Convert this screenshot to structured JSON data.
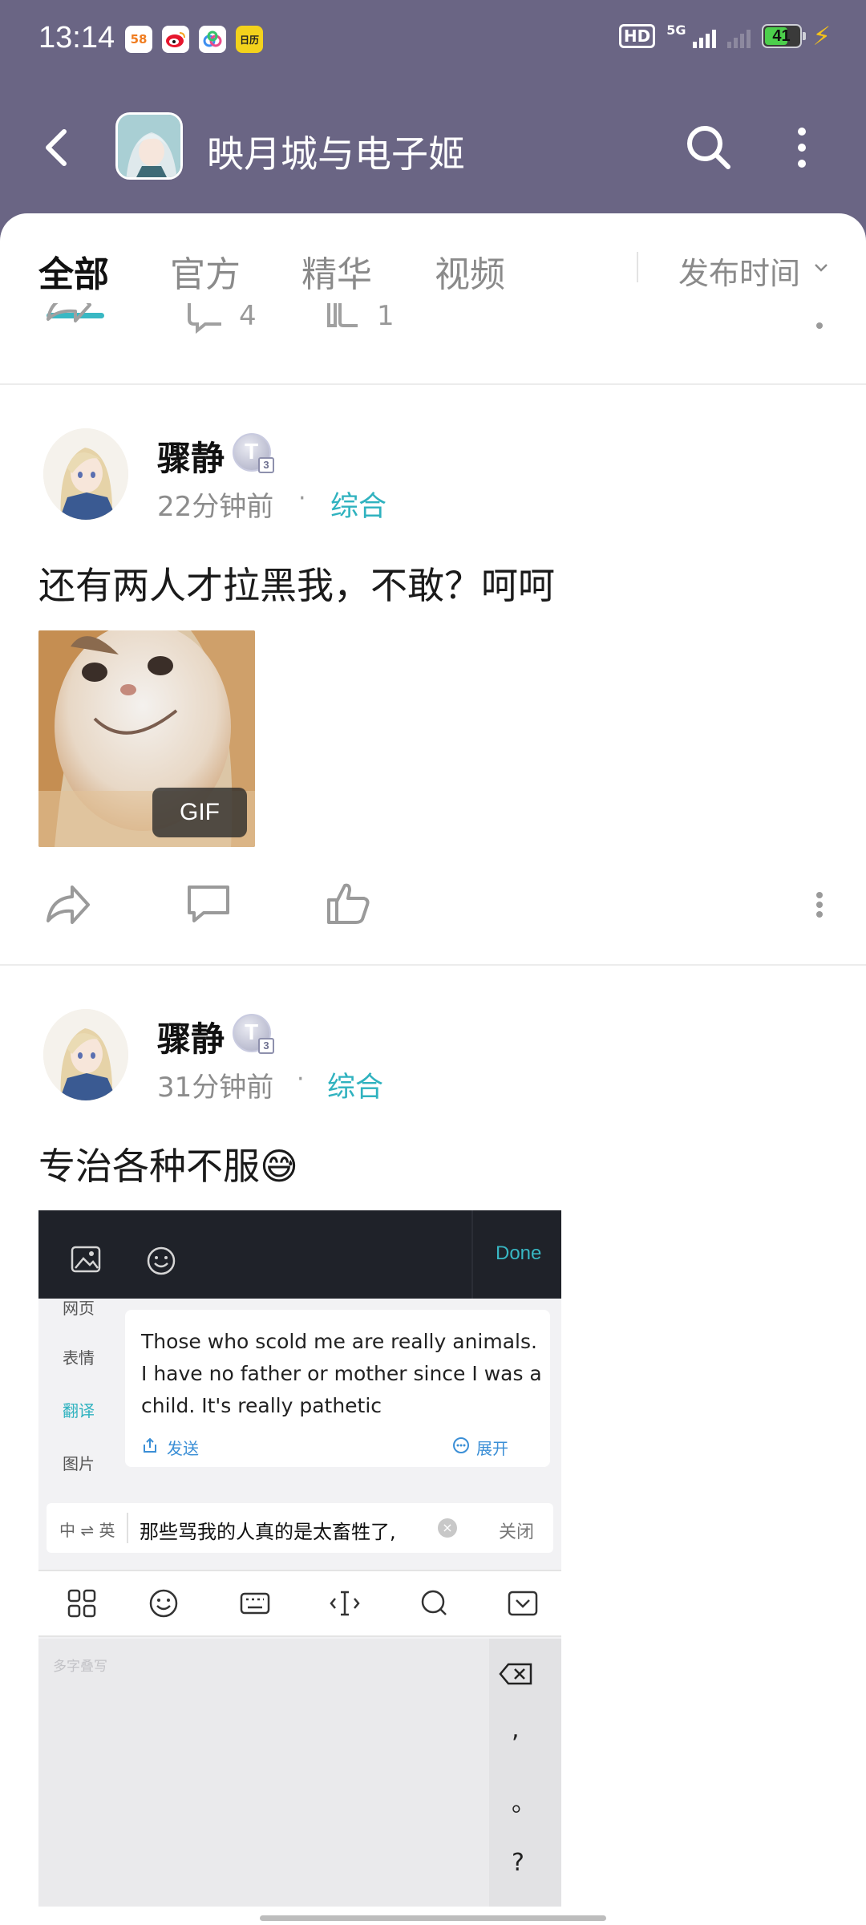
{
  "status_bar": {
    "time": "13:14",
    "app_icons": [
      {
        "name": "58",
        "color": "#f07c1f"
      },
      {
        "name": "weibo-icon",
        "color": "#e6162d"
      },
      {
        "name": "app-icon",
        "color": "#3d8ef0"
      },
      {
        "name": "日历",
        "color": "#f3d21c"
      }
    ],
    "hd_label": "HD",
    "network_label": "5G",
    "battery_level": "41"
  },
  "nav": {
    "title": "映月城与电子姬"
  },
  "tabs": {
    "items": [
      "全部",
      "官方",
      "精华",
      "视频"
    ],
    "active_index": 0,
    "sort_label": "发布时间"
  },
  "partial_post": {
    "comment_count": "4",
    "like_count": "1"
  },
  "posts": [
    {
      "username": "骤静",
      "badge_letter": "T",
      "badge_level": "3",
      "time": "22分钟前",
      "category": "综合",
      "text": "还有两人才拉黑我，不敢？呵呵",
      "media_tag": "GIF"
    },
    {
      "username": "骤静",
      "badge_letter": "T",
      "badge_level": "3",
      "time": "31分钟前",
      "category": "综合",
      "text": "专治各种不服😅",
      "screenshot": {
        "done_label": "Done",
        "side_items": [
          "网页",
          "表情",
          "翻译",
          "图片"
        ],
        "side_active": "翻译",
        "translation_text": "Those who scold me are really animals. I have no father or mother since I was a child. It's really pathetic",
        "send_label": "发送",
        "expand_label": "展开",
        "lang_switch": "中 ⇌ 英",
        "input_text": "那些骂我的人真的是太畜牲了,",
        "close_label": "关闭",
        "kb_hint": "多字叠写",
        "keys": [
          ",",
          "。",
          "?"
        ]
      }
    }
  ],
  "colors": {
    "header_bg": "#6a6584",
    "accent": "#2fb2bf"
  }
}
